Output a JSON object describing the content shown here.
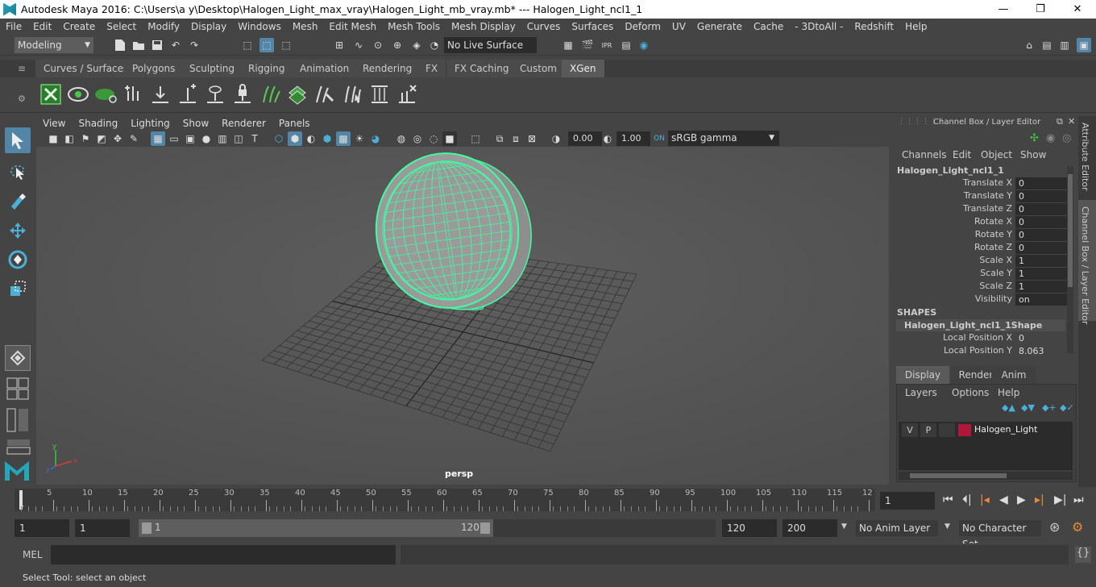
{
  "window": {
    "title": "Autodesk Maya 2016: C:\\Users\\a y\\Desktop\\Halogen_Light_max_vray\\Halogen_Light_mb_vray.mb*   ---   Halogen_Light_ncl1_1",
    "min": "—",
    "max": "❐",
    "close": "✕"
  },
  "menu": [
    "File",
    "Edit",
    "Create",
    "Select",
    "Modify",
    "Display",
    "Windows",
    "Mesh",
    "Edit Mesh",
    "Mesh Tools",
    "Mesh Display",
    "Curves",
    "Surfaces",
    "Deform",
    "UV",
    "Generate",
    "Cache",
    "- 3DtoAll -",
    "Redshift",
    "Help"
  ],
  "status": {
    "mode": "Modeling",
    "live_surface": "No Live Surface"
  },
  "shelf_tabs": [
    "Curves / Surfaces",
    "Polygons",
    "Sculpting",
    "Rigging",
    "Animation",
    "Rendering",
    "FX",
    "FX Caching",
    "Custom",
    "XGen"
  ],
  "shelf_active": "XGen",
  "viewport": {
    "menu": [
      "View",
      "Shading",
      "Lighting",
      "Show",
      "Renderer",
      "Panels"
    ],
    "exposure": "0.00",
    "gamma": "1.00",
    "colorspace": "sRGB gamma",
    "camera": "persp"
  },
  "channel_box": {
    "title": "Channel Box / Layer Editor",
    "menu": [
      "Channels",
      "Edit",
      "Object",
      "Show"
    ],
    "object": "Halogen_Light_ncl1_1",
    "attrs": [
      {
        "label": "Translate X",
        "value": "0"
      },
      {
        "label": "Translate Y",
        "value": "0"
      },
      {
        "label": "Translate Z",
        "value": "0"
      },
      {
        "label": "Rotate X",
        "value": "0"
      },
      {
        "label": "Rotate Y",
        "value": "0"
      },
      {
        "label": "Rotate Z",
        "value": "0"
      },
      {
        "label": "Scale X",
        "value": "1"
      },
      {
        "label": "Scale Y",
        "value": "1"
      },
      {
        "label": "Scale Z",
        "value": "1"
      },
      {
        "label": "Visibility",
        "value": "on"
      }
    ],
    "shapes_header": "SHAPES",
    "shape_name": "Halogen_Light_ncl1_1Shape",
    "shape_attrs": [
      {
        "label": "Local Position X",
        "value": "0"
      },
      {
        "label": "Local Position Y",
        "value": "8.063"
      }
    ]
  },
  "layer_editor": {
    "tabs": [
      "Display",
      "Render",
      "Anim"
    ],
    "menu": [
      "Layers",
      "Options",
      "Help"
    ],
    "layer": {
      "v": "V",
      "p": "P",
      "name": "Halogen_Light",
      "color": "#b0183a"
    }
  },
  "side_tabs": [
    "Attribute Editor",
    "Channel Box / Layer Editor"
  ],
  "timeline": {
    "ticks": [
      "5",
      "10",
      "15",
      "20",
      "25",
      "30",
      "35",
      "40",
      "45",
      "50",
      "55",
      "60",
      "65",
      "70",
      "75",
      "80",
      "85",
      "90",
      "95",
      "100",
      "105",
      "110",
      "115",
      "12"
    ],
    "start_label": "1",
    "current": "1"
  },
  "range": {
    "start": "1",
    "anim_start": "1",
    "slider_start": "1",
    "slider_end": "120",
    "end": "120",
    "anim_end": "200",
    "anim_layer": "No Anim Layer",
    "char_set": "No Character Set"
  },
  "cmd": {
    "lang": "MEL"
  },
  "help": "Select Tool: select an object",
  "colors": {
    "wire": "#3dffa0",
    "accent": "#5285a6"
  }
}
